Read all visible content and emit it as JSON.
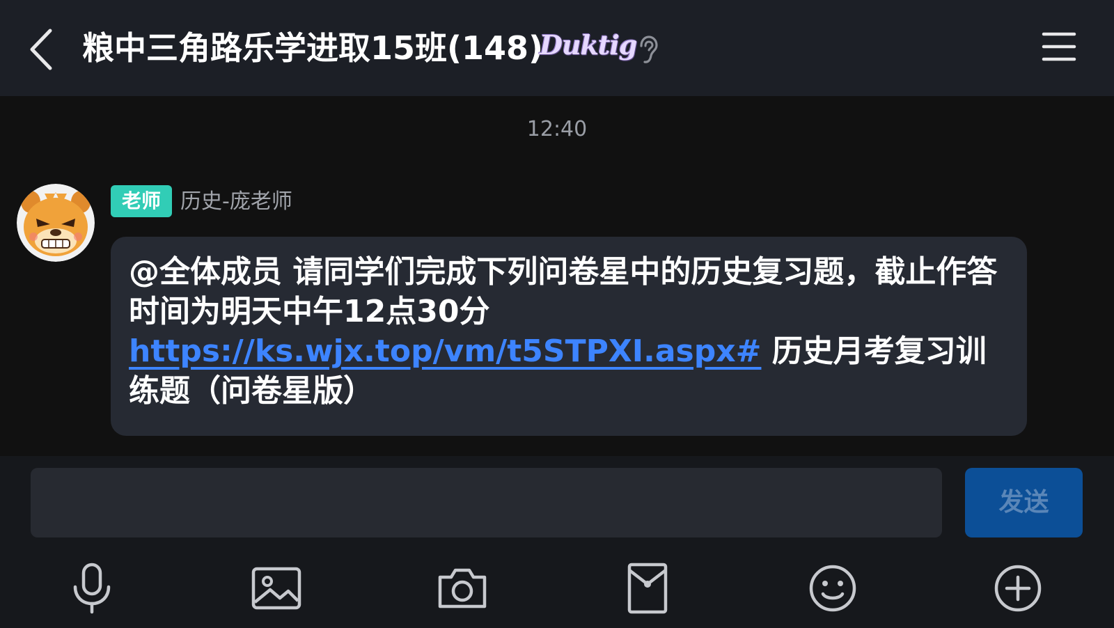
{
  "header": {
    "title": "粮中三角路乐学进取15班(148)",
    "badge_text": "Duktig",
    "back_icon": "chevron-left-icon",
    "ear_icon": "ear-icon",
    "menu_icon": "hamburger-menu-icon"
  },
  "chat": {
    "timestamp": "12:40",
    "message": {
      "role_tag": "老师",
      "sender": "历史-庞老师",
      "text_before": "@全体成员 请同学们完成下列问卷星中的历史复习题，截止作答时间为明天中午12点30分",
      "link": "https://ks.wjx.top/vm/t5STPXI.aspx#",
      "text_after": " 历史月考复习训练题（问卷星版）"
    }
  },
  "input_bar": {
    "placeholder": "",
    "send_label": "发送",
    "tools": [
      "microphone-icon",
      "image-icon",
      "camera-icon",
      "red-packet-icon",
      "emoji-icon",
      "plus-circle-icon"
    ]
  },
  "colors": {
    "accent_teal": "#31cdb6",
    "link_blue": "#3d84ff",
    "send_button": "#0c4f97"
  }
}
